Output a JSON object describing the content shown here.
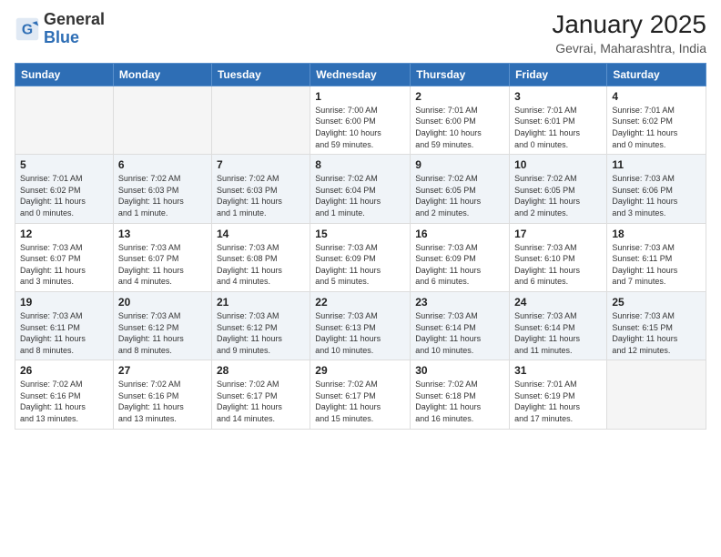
{
  "header": {
    "logo_general": "General",
    "logo_blue": "Blue",
    "month_year": "January 2025",
    "location": "Gevrai, Maharashtra, India"
  },
  "weekdays": [
    "Sunday",
    "Monday",
    "Tuesday",
    "Wednesday",
    "Thursday",
    "Friday",
    "Saturday"
  ],
  "weeks": [
    [
      {
        "day": "",
        "info": ""
      },
      {
        "day": "",
        "info": ""
      },
      {
        "day": "",
        "info": ""
      },
      {
        "day": "1",
        "info": "Sunrise: 7:00 AM\nSunset: 6:00 PM\nDaylight: 10 hours\nand 59 minutes."
      },
      {
        "day": "2",
        "info": "Sunrise: 7:01 AM\nSunset: 6:00 PM\nDaylight: 10 hours\nand 59 minutes."
      },
      {
        "day": "3",
        "info": "Sunrise: 7:01 AM\nSunset: 6:01 PM\nDaylight: 11 hours\nand 0 minutes."
      },
      {
        "day": "4",
        "info": "Sunrise: 7:01 AM\nSunset: 6:02 PM\nDaylight: 11 hours\nand 0 minutes."
      }
    ],
    [
      {
        "day": "5",
        "info": "Sunrise: 7:01 AM\nSunset: 6:02 PM\nDaylight: 11 hours\nand 0 minutes."
      },
      {
        "day": "6",
        "info": "Sunrise: 7:02 AM\nSunset: 6:03 PM\nDaylight: 11 hours\nand 1 minute."
      },
      {
        "day": "7",
        "info": "Sunrise: 7:02 AM\nSunset: 6:03 PM\nDaylight: 11 hours\nand 1 minute."
      },
      {
        "day": "8",
        "info": "Sunrise: 7:02 AM\nSunset: 6:04 PM\nDaylight: 11 hours\nand 1 minute."
      },
      {
        "day": "9",
        "info": "Sunrise: 7:02 AM\nSunset: 6:05 PM\nDaylight: 11 hours\nand 2 minutes."
      },
      {
        "day": "10",
        "info": "Sunrise: 7:02 AM\nSunset: 6:05 PM\nDaylight: 11 hours\nand 2 minutes."
      },
      {
        "day": "11",
        "info": "Sunrise: 7:03 AM\nSunset: 6:06 PM\nDaylight: 11 hours\nand 3 minutes."
      }
    ],
    [
      {
        "day": "12",
        "info": "Sunrise: 7:03 AM\nSunset: 6:07 PM\nDaylight: 11 hours\nand 3 minutes."
      },
      {
        "day": "13",
        "info": "Sunrise: 7:03 AM\nSunset: 6:07 PM\nDaylight: 11 hours\nand 4 minutes."
      },
      {
        "day": "14",
        "info": "Sunrise: 7:03 AM\nSunset: 6:08 PM\nDaylight: 11 hours\nand 4 minutes."
      },
      {
        "day": "15",
        "info": "Sunrise: 7:03 AM\nSunset: 6:09 PM\nDaylight: 11 hours\nand 5 minutes."
      },
      {
        "day": "16",
        "info": "Sunrise: 7:03 AM\nSunset: 6:09 PM\nDaylight: 11 hours\nand 6 minutes."
      },
      {
        "day": "17",
        "info": "Sunrise: 7:03 AM\nSunset: 6:10 PM\nDaylight: 11 hours\nand 6 minutes."
      },
      {
        "day": "18",
        "info": "Sunrise: 7:03 AM\nSunset: 6:11 PM\nDaylight: 11 hours\nand 7 minutes."
      }
    ],
    [
      {
        "day": "19",
        "info": "Sunrise: 7:03 AM\nSunset: 6:11 PM\nDaylight: 11 hours\nand 8 minutes."
      },
      {
        "day": "20",
        "info": "Sunrise: 7:03 AM\nSunset: 6:12 PM\nDaylight: 11 hours\nand 8 minutes."
      },
      {
        "day": "21",
        "info": "Sunrise: 7:03 AM\nSunset: 6:12 PM\nDaylight: 11 hours\nand 9 minutes."
      },
      {
        "day": "22",
        "info": "Sunrise: 7:03 AM\nSunset: 6:13 PM\nDaylight: 11 hours\nand 10 minutes."
      },
      {
        "day": "23",
        "info": "Sunrise: 7:03 AM\nSunset: 6:14 PM\nDaylight: 11 hours\nand 10 minutes."
      },
      {
        "day": "24",
        "info": "Sunrise: 7:03 AM\nSunset: 6:14 PM\nDaylight: 11 hours\nand 11 minutes."
      },
      {
        "day": "25",
        "info": "Sunrise: 7:03 AM\nSunset: 6:15 PM\nDaylight: 11 hours\nand 12 minutes."
      }
    ],
    [
      {
        "day": "26",
        "info": "Sunrise: 7:02 AM\nSunset: 6:16 PM\nDaylight: 11 hours\nand 13 minutes."
      },
      {
        "day": "27",
        "info": "Sunrise: 7:02 AM\nSunset: 6:16 PM\nDaylight: 11 hours\nand 13 minutes."
      },
      {
        "day": "28",
        "info": "Sunrise: 7:02 AM\nSunset: 6:17 PM\nDaylight: 11 hours\nand 14 minutes."
      },
      {
        "day": "29",
        "info": "Sunrise: 7:02 AM\nSunset: 6:17 PM\nDaylight: 11 hours\nand 15 minutes."
      },
      {
        "day": "30",
        "info": "Sunrise: 7:02 AM\nSunset: 6:18 PM\nDaylight: 11 hours\nand 16 minutes."
      },
      {
        "day": "31",
        "info": "Sunrise: 7:01 AM\nSunset: 6:19 PM\nDaylight: 11 hours\nand 17 minutes."
      },
      {
        "day": "",
        "info": ""
      }
    ]
  ]
}
